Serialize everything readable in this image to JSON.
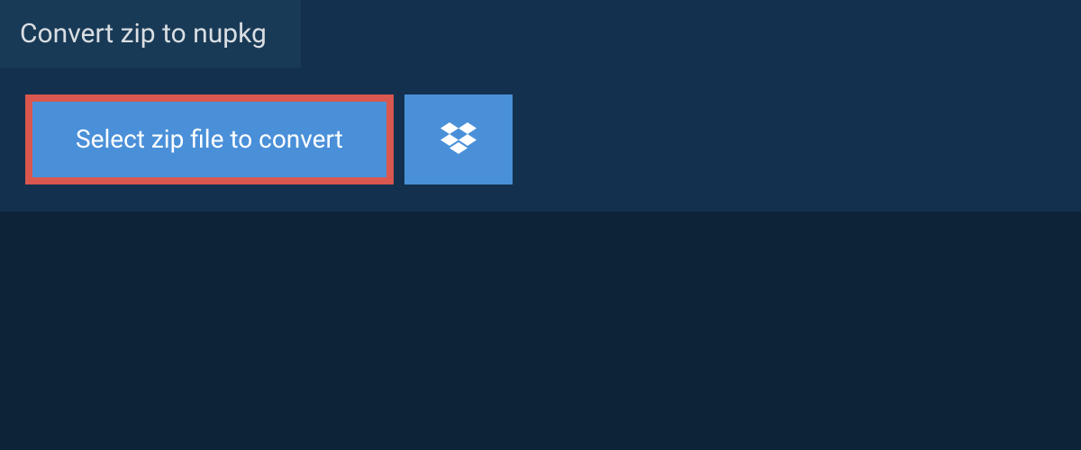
{
  "header": {
    "title": "Convert zip to nupkg"
  },
  "actions": {
    "select_file_label": "Select zip file to convert"
  }
}
